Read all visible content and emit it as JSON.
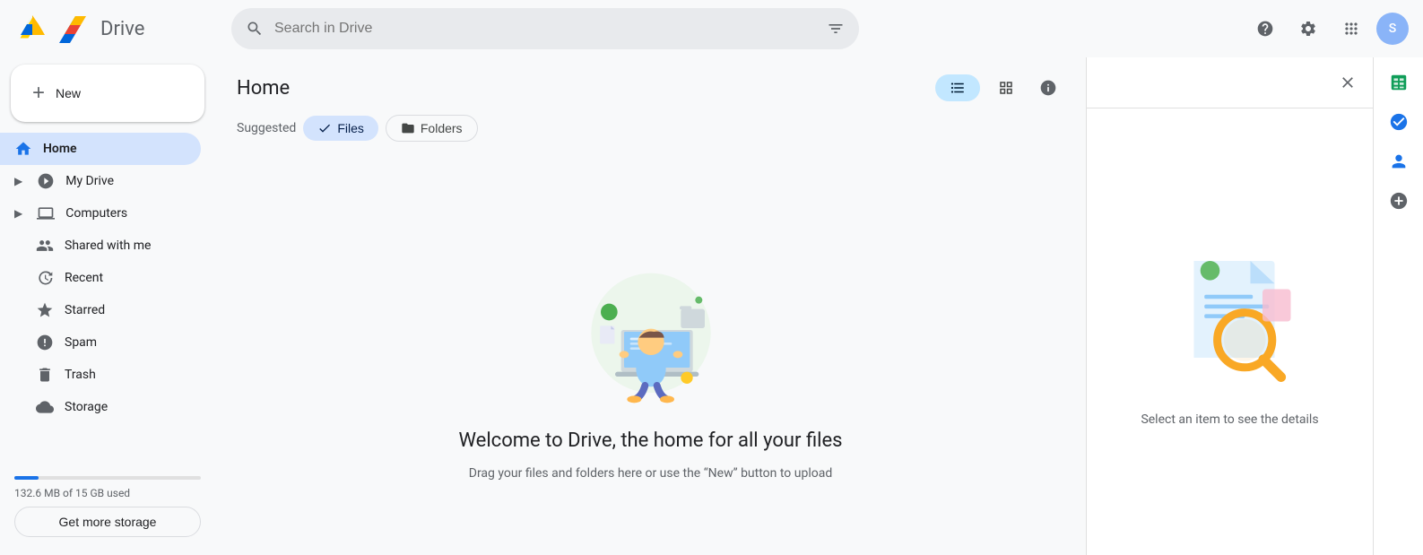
{
  "app": {
    "logo_text": "Drive",
    "title": "Drive"
  },
  "topbar": {
    "search_placeholder": "Search in Drive",
    "help_icon": "help-circle-icon",
    "settings_icon": "gear-icon",
    "apps_icon": "grid-icon",
    "avatar_initials": "S"
  },
  "sidebar": {
    "new_button_label": "New",
    "items": [
      {
        "id": "home",
        "label": "Home",
        "icon": "home-icon",
        "active": true,
        "expandable": false
      },
      {
        "id": "my-drive",
        "label": "My Drive",
        "icon": "drive-icon",
        "active": false,
        "expandable": true
      },
      {
        "id": "computers",
        "label": "Computers",
        "icon": "monitor-icon",
        "active": false,
        "expandable": true
      },
      {
        "id": "shared-with-me",
        "label": "Shared with me",
        "icon": "users-icon",
        "active": false,
        "expandable": false
      },
      {
        "id": "recent",
        "label": "Recent",
        "icon": "clock-icon",
        "active": false,
        "expandable": false
      },
      {
        "id": "starred",
        "label": "Starred",
        "icon": "star-icon",
        "active": false,
        "expandable": false
      },
      {
        "id": "spam",
        "label": "Spam",
        "icon": "warning-icon",
        "active": false,
        "expandable": false
      },
      {
        "id": "trash",
        "label": "Trash",
        "icon": "trash-icon",
        "active": false,
        "expandable": false
      },
      {
        "id": "storage",
        "label": "Storage",
        "icon": "cloud-icon",
        "active": false,
        "expandable": false
      }
    ],
    "storage_used_text": "132.6 MB of 15 GB used",
    "get_storage_label": "Get more storage"
  },
  "content": {
    "title": "Home",
    "view_list_label": "",
    "view_grid_label": "",
    "filter_suggested_label": "Suggested",
    "filter_files_label": "Files",
    "filter_folders_label": "Folders",
    "empty_title": "Welcome to Drive, the home for all your files",
    "empty_subtitle": "Drag your files and folders here or use the “New” button to upload"
  },
  "right_panel": {
    "details_text": "Select an item to see the details"
  },
  "icon_strip": {
    "icons": [
      {
        "id": "sheets-icon",
        "label": "Google Sheets"
      },
      {
        "id": "tasks-icon",
        "label": "Tasks"
      },
      {
        "id": "contacts-icon",
        "label": "Contacts"
      }
    ]
  }
}
